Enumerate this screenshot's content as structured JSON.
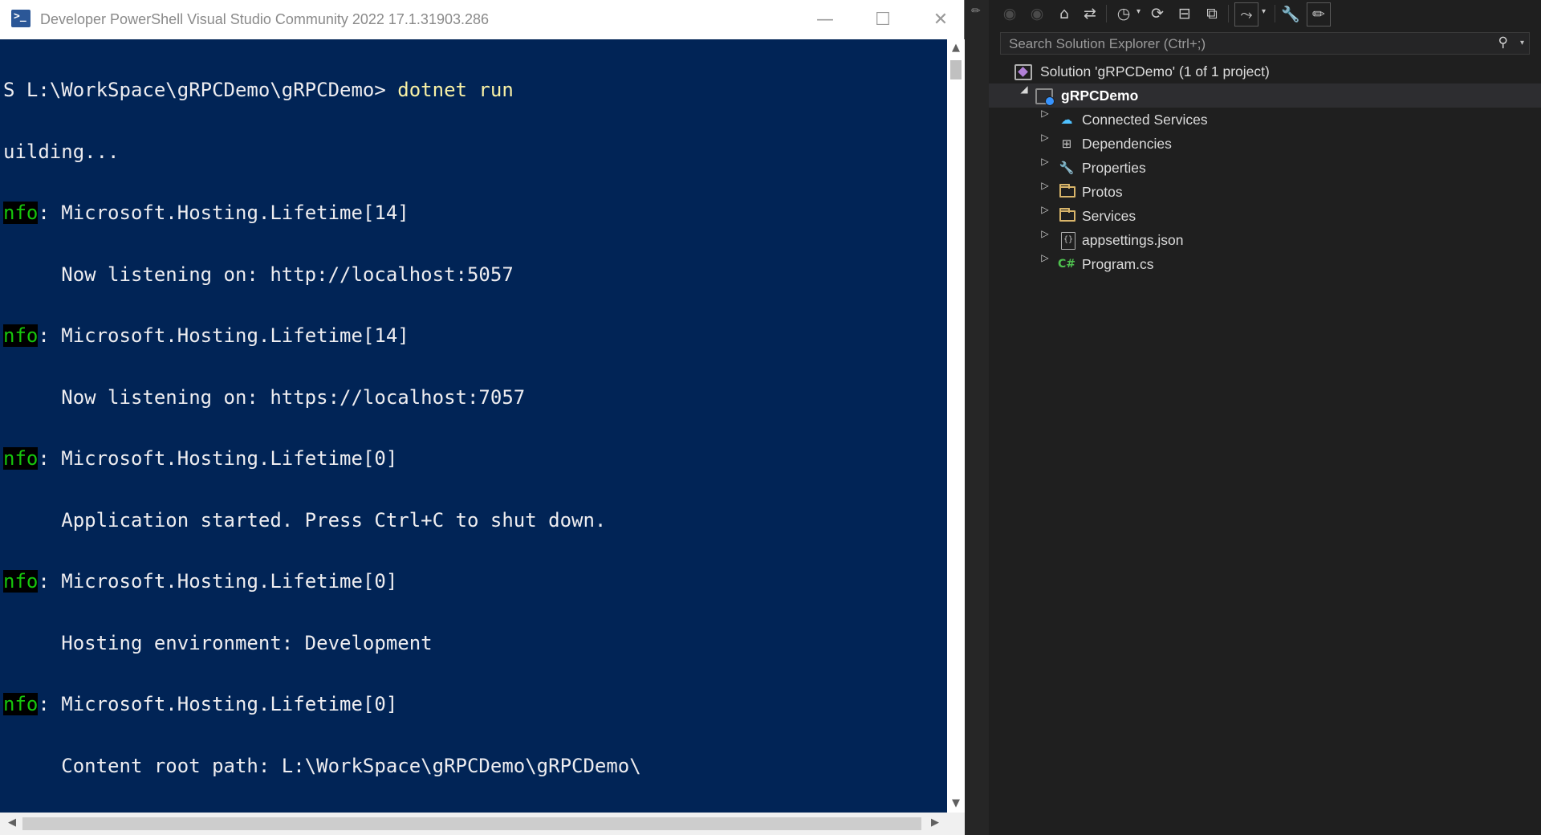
{
  "powershell": {
    "title": "Developer PowerShell Visual Studio Community 2022 17.1.31903.286",
    "window_buttons": {
      "minimize": "—",
      "maximize": "☐",
      "close": "✕"
    },
    "lines": [
      {
        "prefix": "",
        "text": "S L:\\WorkSpace\\gRPCDemo\\gRPCDemo> ",
        "cmd": "dotnet run"
      },
      {
        "prefix": "",
        "text": "uilding...",
        "cmd": ""
      },
      {
        "prefix": "nfo",
        "text": ": Microsoft.Hosting.Lifetime[14]",
        "cmd": ""
      },
      {
        "prefix": "",
        "text": "     Now listening on: http://localhost:5057",
        "cmd": ""
      },
      {
        "prefix": "nfo",
        "text": ": Microsoft.Hosting.Lifetime[14]",
        "cmd": ""
      },
      {
        "prefix": "",
        "text": "     Now listening on: https://localhost:7057",
        "cmd": ""
      },
      {
        "prefix": "nfo",
        "text": ": Microsoft.Hosting.Lifetime[0]",
        "cmd": ""
      },
      {
        "prefix": "",
        "text": "     Application started. Press Ctrl+C to shut down.",
        "cmd": ""
      },
      {
        "prefix": "nfo",
        "text": ": Microsoft.Hosting.Lifetime[0]",
        "cmd": ""
      },
      {
        "prefix": "",
        "text": "     Hosting environment: Development",
        "cmd": ""
      },
      {
        "prefix": "nfo",
        "text": ": Microsoft.Hosting.Lifetime[0]",
        "cmd": ""
      },
      {
        "prefix": "",
        "text": "     Content root path: L:\\WorkSpace\\gRPCDemo\\gRPCDemo\\",
        "cmd": ""
      }
    ],
    "scroll": {
      "up": "▲",
      "down": "▼",
      "left": "◀",
      "right": "▶"
    }
  },
  "solution_explorer": {
    "search_placeholder": "Search Solution Explorer (Ctrl+;)",
    "search_icon": "⚲",
    "search_dropdown": "▾",
    "toolbar": {
      "back_icon": "◉",
      "forward_icon": "◉",
      "home_icon": "⌂",
      "switch_views_icon": "⇄",
      "pending_changes_icon": "◷",
      "refresh_icon": "⟳",
      "collapse_all_icon": "⊟",
      "show_all_files_icon": "⧉",
      "preview_icon": "⤳",
      "properties_icon": "🔧",
      "dropdown": "▾",
      "pin_icon": "✏"
    },
    "tree": {
      "solution": "Solution 'gRPCDemo' (1 of 1 project)",
      "project": "gRPCDemo",
      "items": [
        {
          "label": "Connected Services",
          "icon": "cloud-icon",
          "glyph": "☁"
        },
        {
          "label": "Dependencies",
          "icon": "dependencies-icon",
          "glyph": "⊞"
        },
        {
          "label": "Properties",
          "icon": "properties-icon",
          "glyph": "🔧"
        },
        {
          "label": "Protos",
          "icon": "folder-icon",
          "glyph": ""
        },
        {
          "label": "Services",
          "icon": "folder-icon",
          "glyph": ""
        },
        {
          "label": "appsettings.json",
          "icon": "json-file-icon",
          "glyph": "{}"
        },
        {
          "label": "Program.cs",
          "icon": "csharp-file-icon",
          "glyph": "C#"
        }
      ],
      "expand_glyph": "▷",
      "collapse_glyph": "◢"
    }
  }
}
